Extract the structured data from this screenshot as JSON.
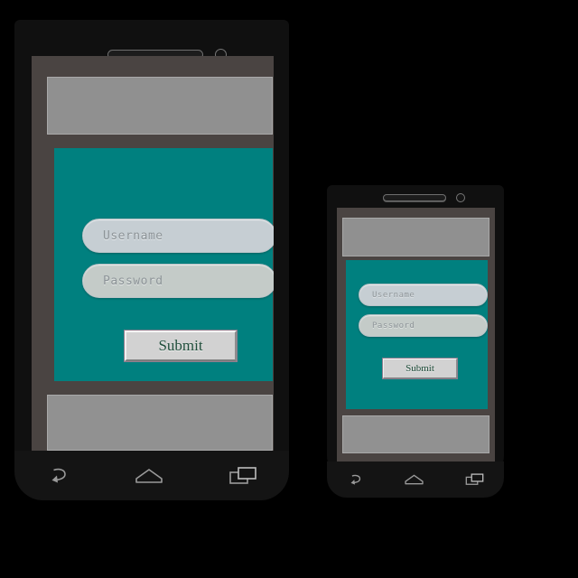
{
  "scene": {
    "background_color": "#000000",
    "description": "Two Android phone mockups showing a login screen"
  },
  "theme": {
    "teal": "#00807f",
    "gray_panel": "#909090",
    "frame": "#4a4442",
    "navbar": "#141414",
    "submit_text": "#1f4d3a",
    "field_username_bg": "#c6ced3",
    "field_password_bg": "#c4cbc8",
    "placeholder_text": "#8d9498"
  },
  "phones": [
    {
      "id": "phone-large",
      "size_label": "large",
      "hardware": {
        "speaker_name": "speaker-grille",
        "camera_name": "front-camera"
      },
      "login_form": {
        "username": {
          "placeholder": "Username",
          "value": ""
        },
        "password": {
          "placeholder": "Password",
          "value": ""
        },
        "submit_label": "Submit"
      },
      "navbar": {
        "back_icon": "back-arrow-icon",
        "home_icon": "home-icon",
        "recents_icon": "recents-icon"
      }
    },
    {
      "id": "phone-small",
      "size_label": "small",
      "hardware": {
        "speaker_name": "speaker-grille",
        "camera_name": "front-camera"
      },
      "login_form": {
        "username": {
          "placeholder": "Username",
          "value": ""
        },
        "password": {
          "placeholder": "Password",
          "value": ""
        },
        "submit_label": "Submit"
      },
      "navbar": {
        "back_icon": "back-arrow-icon",
        "home_icon": "home-icon",
        "recents_icon": "recents-icon"
      }
    }
  ]
}
